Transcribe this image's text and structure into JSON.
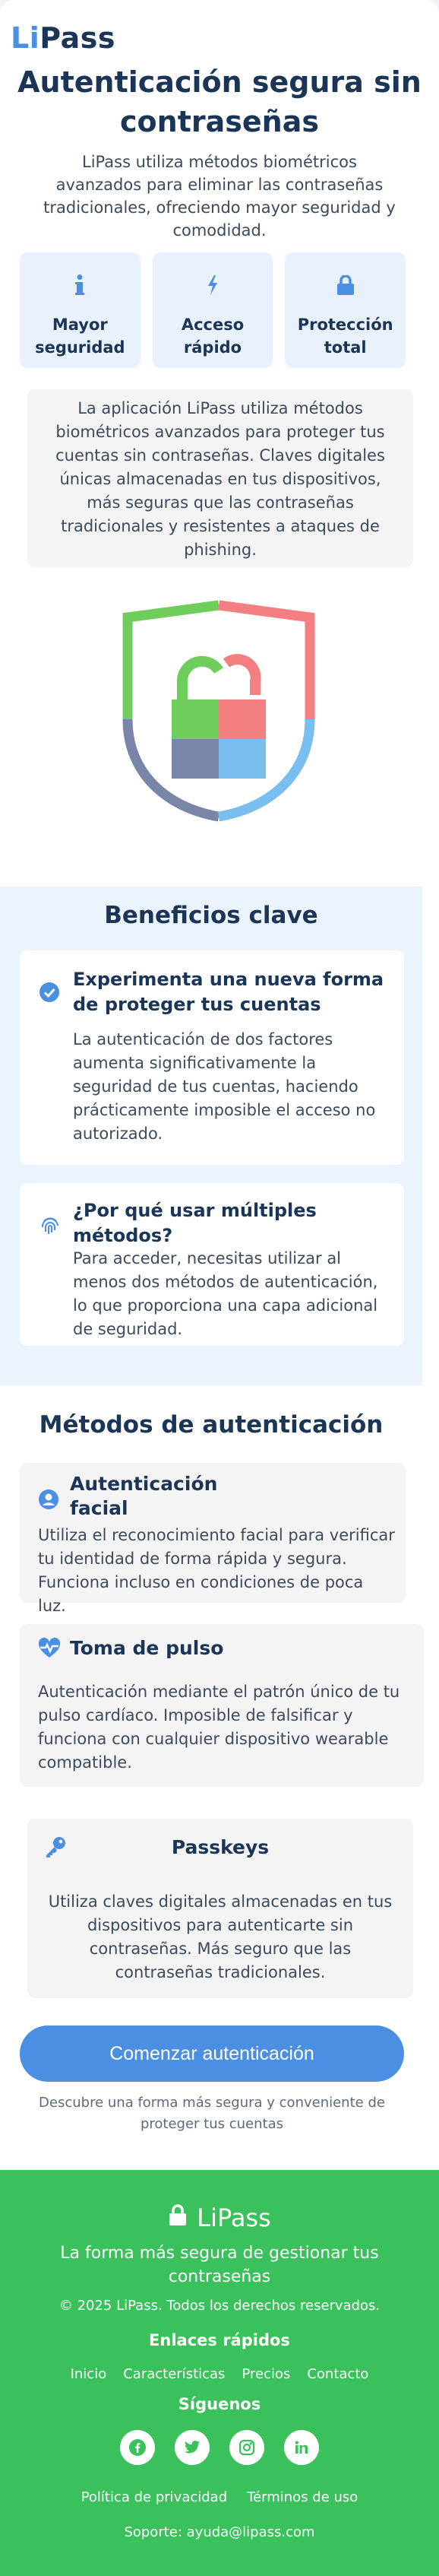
{
  "brand": {
    "prefix": "Li",
    "suffix": "Pass"
  },
  "hero": {
    "title": "Autenticación segura sin contraseñas",
    "subtitle": "LiPass utiliza métodos biométricos avanzados para eliminar las contraseñas tradicionales, ofreciendo mayor seguridad y comodidad."
  },
  "features": [
    {
      "icon": "info-icon",
      "label": "Mayor seguridad"
    },
    {
      "icon": "lightning-icon",
      "label": "Acceso rápido"
    },
    {
      "icon": "lock-icon",
      "label": "Protección total"
    }
  ],
  "intro": "La aplicación LiPass utiliza métodos biométricos avanzados para proteger tus cuentas sin contraseñas. Claves digitales únicas almacenadas en tus dispositivos, más seguras que las contraseñas tradicionales y resistentes a ataques de phishing.",
  "benefits": {
    "title": "Beneficios clave",
    "items": [
      {
        "icon": "check-circle-icon",
        "title": "Experimenta una nueva forma de proteger tus cuentas",
        "text": "La autenticación de dos factores aumenta significativamente la seguridad de tus cuentas, haciendo prácticamente imposible el acceso no autorizado."
      },
      {
        "icon": "fingerprint-icon",
        "title": "¿Por qué usar múltiples métodos?",
        "text": "Para acceder, necesitas utilizar al menos dos métodos de autenticación, lo que proporciona una capa adicional de seguridad."
      }
    ]
  },
  "methods": {
    "title": "Métodos de autenticación",
    "items": [
      {
        "icon": "user-circle-icon",
        "title": "Autenticación facial",
        "text": "Utiliza el reconocimiento facial para verificar tu identidad de forma rápida y segura. Funciona incluso en condiciones de poca luz."
      },
      {
        "icon": "heart-pulse-icon",
        "title": "Toma de pulso",
        "text": "Autenticación mediante el patrón único de tu pulso cardíaco. Imposible de falsificar y funciona con cualquier dispositivo wearable compatible."
      },
      {
        "icon": "key-icon",
        "title": "Passkeys",
        "text": "Utiliza claves digitales almacenadas en tus dispositivos para autenticarte sin contraseñas. Más seguro que las contraseñas tradicionales."
      }
    ]
  },
  "cta": {
    "label": "Comenzar autenticación",
    "subtitle": "Descubre una forma más segura y conveniente de proteger tus cuentas"
  },
  "footer": {
    "brand": "LiPass",
    "tagline": "La forma más segura de gestionar tus contraseñas",
    "copyright": "© 2025 LiPass. Todos los derechos reservados.",
    "quick_links_title": "Enlaces rápidos",
    "quick_links": [
      "Inicio",
      "Características",
      "Precios",
      "Contacto"
    ],
    "social_title": "Síguenos",
    "social": [
      "facebook-icon",
      "twitter-icon",
      "instagram-icon",
      "linkedin-icon"
    ],
    "legal": [
      "Política de privacidad",
      "Términos de uso"
    ],
    "support": "Soporte: ayuda@lipass.com"
  },
  "colors": {
    "primary": "#4a8fe2",
    "navy": "#1b3557",
    "footer": "#3ac15b",
    "benefits_bg": "#ebf3fc",
    "card_bg": "#f4f4f5"
  }
}
